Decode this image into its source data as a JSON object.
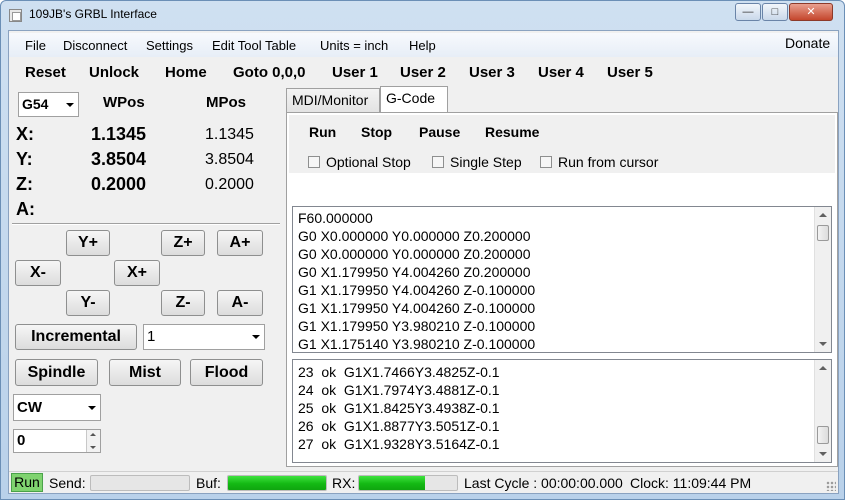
{
  "window": {
    "title": "109JB's GRBL Interface",
    "min_glyph": "—",
    "max_glyph": "□",
    "close_glyph": "✕"
  },
  "menu": {
    "items": [
      "File",
      "Disconnect",
      "Settings",
      "Edit Tool Table",
      "Units = inch",
      "Help"
    ],
    "donate": "Donate"
  },
  "commands": [
    "Reset",
    "Unlock",
    "Home",
    "Goto 0,0,0",
    "User 1",
    "User 2",
    "User 3",
    "User 4",
    "User 5"
  ],
  "coords": {
    "system": "G54",
    "wpos_header": "WPos",
    "mpos_header": "MPos",
    "axes": [
      {
        "label": "X:",
        "wpos": "1.1345",
        "mpos": "1.1345"
      },
      {
        "label": "Y:",
        "wpos": "3.8504",
        "mpos": "3.8504"
      },
      {
        "label": "Z:",
        "wpos": "0.2000",
        "mpos": "0.2000"
      },
      {
        "label": "A:",
        "wpos": "",
        "mpos": ""
      }
    ]
  },
  "jog": {
    "y_plus": "Y+",
    "z_plus": "Z+",
    "a_plus": "A+",
    "x_minus": "X-",
    "x_plus": "X+",
    "y_minus": "Y-",
    "z_minus": "Z-",
    "a_minus": "A-",
    "mode": "Incremental",
    "step": "1"
  },
  "coolant": {
    "spindle": "Spindle",
    "mist": "Mist",
    "flood": "Flood",
    "direction": "CW",
    "speed": "0"
  },
  "tabs": [
    {
      "label": "MDI/Monitor",
      "active": false
    },
    {
      "label": "G-Code",
      "active": true
    }
  ],
  "gcode": {
    "buttons": [
      "Run",
      "Stop",
      "Pause",
      "Resume"
    ],
    "checkboxes": [
      "Optional Stop",
      "Single Step",
      "Run from cursor"
    ],
    "lines": [
      "F60.000000",
      "G0 X0.000000 Y0.000000 Z0.200000",
      "G0 X0.000000 Y0.000000 Z0.200000",
      "G0 X1.179950 Y4.004260 Z0.200000",
      "G1 X1.179950 Y4.004260 Z-0.100000",
      "G1 X1.179950 Y4.004260 Z-0.100000",
      "G1 X1.179950 Y3.980210 Z-0.100000",
      "G1 X1.175140 Y3.980210 Z-0.100000"
    ],
    "log": [
      "23  ok  G1X1.7466Y3.4825Z-0.1",
      "24  ok  G1X1.7974Y3.4881Z-0.1",
      "25  ok  G1X1.8425Y3.4938Z-0.1",
      "26  ok  G1X1.8877Y3.5051Z-0.1",
      "27  ok  G1X1.9328Y3.5164Z-0.1"
    ]
  },
  "status": {
    "state": "Run",
    "send_label": "Send:",
    "send_progress": 0.0,
    "buf_label": "Buf:",
    "buf_progress": 1.0,
    "rx_label": "RX:",
    "rx_progress": 0.67,
    "last_cycle": "Last Cycle : 00:00:00.000",
    "clock": "Clock: 11:09:44 PM",
    "run_color": "#7fd36f",
    "progress_color": "#14b914"
  }
}
